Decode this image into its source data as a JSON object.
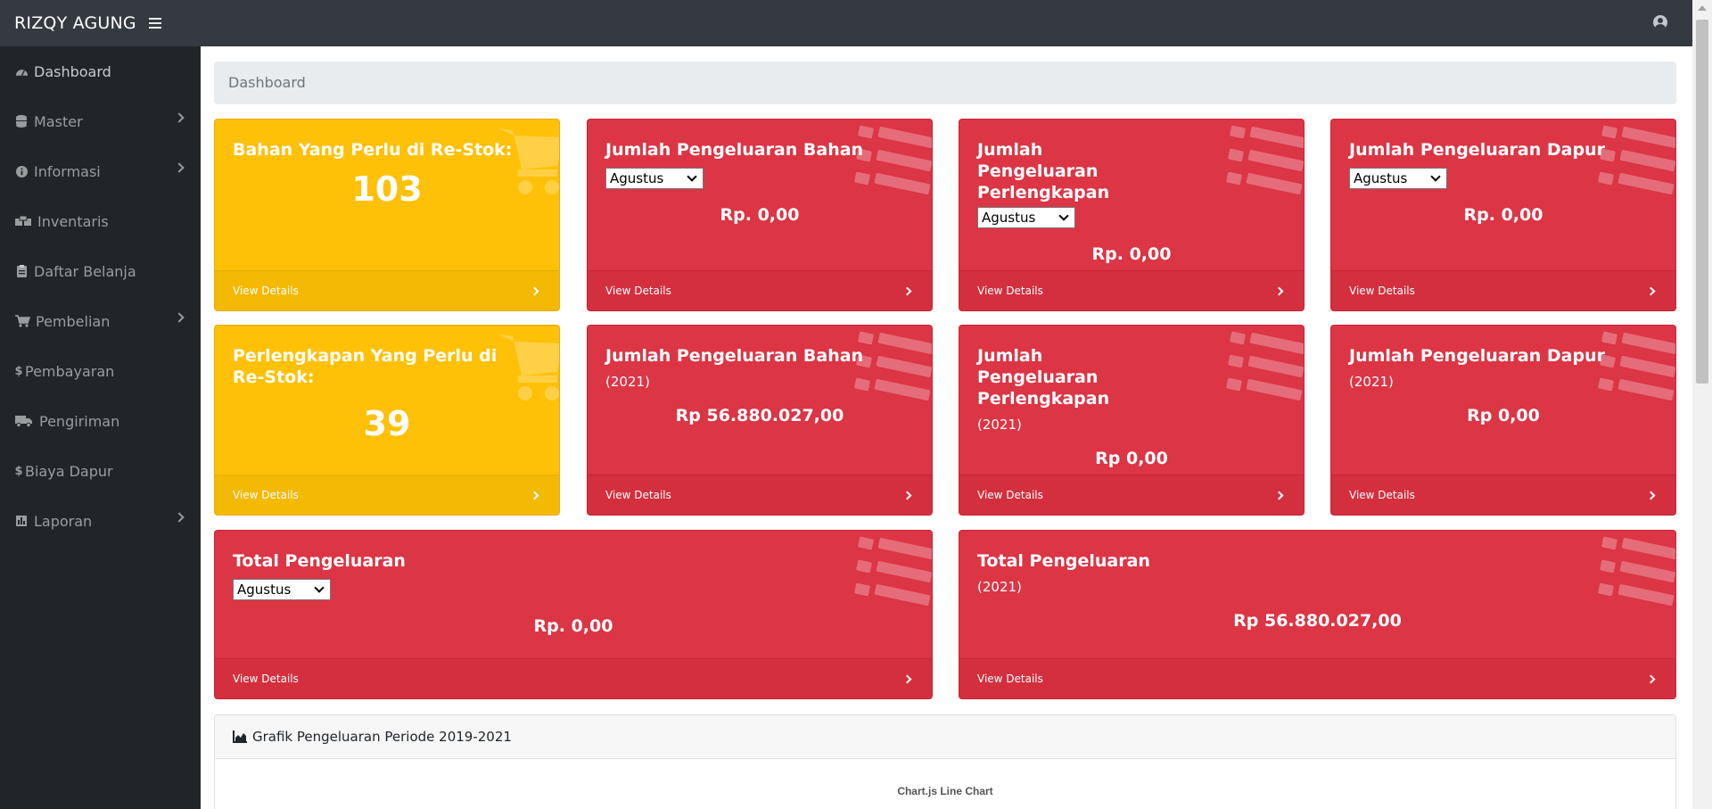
{
  "app": {
    "brand": "RIZQY AGUNG"
  },
  "sidebar": {
    "items": [
      {
        "label": "Dashboard",
        "icon": "tachometer-icon",
        "has_submenu": false
      },
      {
        "label": "Master",
        "icon": "database-icon",
        "has_submenu": true
      },
      {
        "label": "Informasi",
        "icon": "info-circle-icon",
        "has_submenu": true
      },
      {
        "label": "Inventaris",
        "icon": "boxes-icon",
        "has_submenu": false
      },
      {
        "label": "Daftar Belanja",
        "icon": "clipboard-icon",
        "has_submenu": false
      },
      {
        "label": "Pembelian",
        "icon": "shopping-cart-icon",
        "has_submenu": true
      },
      {
        "label": "Pembayaran",
        "icon": "dollar-icon",
        "has_submenu": false
      },
      {
        "label": "Pengiriman",
        "icon": "truck-icon",
        "has_submenu": false
      },
      {
        "label": "Biaya Dapur",
        "icon": "dollar-icon",
        "has_submenu": false
      },
      {
        "label": "Laporan",
        "icon": "bar-chart-icon",
        "has_submenu": true
      }
    ]
  },
  "breadcrumb": "Dashboard",
  "colors": {
    "warning": "#ffc107",
    "danger": "#dc3545",
    "navbar": "#343a40",
    "sidebar": "#212529"
  },
  "cards": {
    "restock_bahan": {
      "title": "Bahan Yang Perlu di Re-Stok:",
      "value": "103",
      "footer": "View Details"
    },
    "bahan_month": {
      "title": "Jumlah Pengeluaran Bahan",
      "select": "Agustus",
      "amount": "Rp. 0,00",
      "footer": "View Details"
    },
    "perlengkapan_month": {
      "title": "Jumlah Pengeluaran Perlengkapan",
      "select": "Agustus",
      "amount": "Rp. 0,00",
      "footer": "View Details"
    },
    "dapur_month": {
      "title": "Jumlah Pengeluaran Dapur",
      "select": "Agustus",
      "amount": "Rp. 0,00",
      "footer": "View Details"
    },
    "restock_perlengkapan": {
      "title": "Perlengkapan Yang Perlu di Re-Stok:",
      "value": "39",
      "footer": "View Details"
    },
    "bahan_year": {
      "title": "Jumlah Pengeluaran Bahan",
      "subtitle": "(2021)",
      "amount": "Rp 56.880.027,00",
      "footer": "View Details"
    },
    "perlengkapan_year": {
      "title": "Jumlah Pengeluaran Perlengkapan",
      "subtitle": "(2021)",
      "amount": "Rp 0,00",
      "footer": "View Details"
    },
    "dapur_year": {
      "title": "Jumlah Pengeluaran Dapur",
      "subtitle": "(2021)",
      "amount": "Rp 0,00",
      "footer": "View Details"
    },
    "total_month": {
      "title": "Total Pengeluaran",
      "select": "Agustus",
      "amount": "Rp. 0,00",
      "footer": "View Details"
    },
    "total_year": {
      "title": "Total Pengeluaran",
      "subtitle": "(2021)",
      "amount": "Rp 56.880.027,00",
      "footer": "View Details"
    }
  },
  "chart_panel": {
    "header": "Grafik Pengeluaran Periode 2019-2021",
    "chart_title": "Chart.js Line Chart"
  }
}
